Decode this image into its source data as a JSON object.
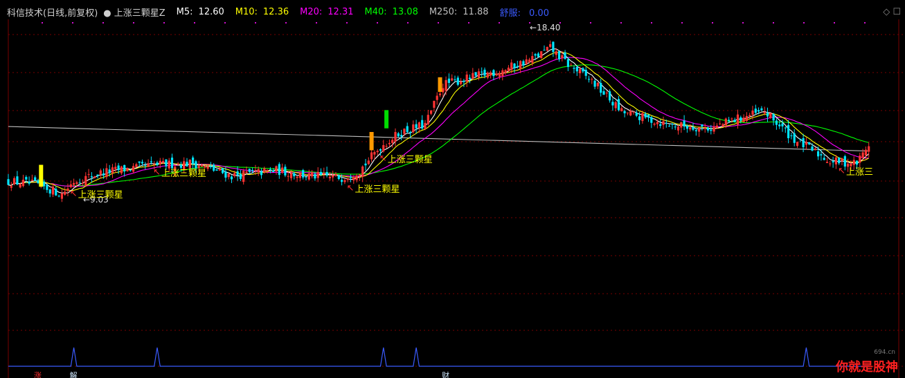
{
  "header": {
    "title": "科信技术(日线,前复权)",
    "indicator": "上涨三颗星Z",
    "ma": [
      {
        "label": "M5:",
        "value": "12.60",
        "color": "#ffffff"
      },
      {
        "label": "M10:",
        "value": "12.36",
        "color": "#ffff00"
      },
      {
        "label": "M20:",
        "value": "12.31",
        "color": "#ff00ff"
      },
      {
        "label": "M40:",
        "value": "13.08",
        "color": "#00ff00"
      },
      {
        "label": "M250:",
        "value": "11.88",
        "color": "#bfbfbf"
      }
    ],
    "extra_label": "舒服:",
    "extra_value": "0.00",
    "extra_color": "#3b5bff"
  },
  "colors": {
    "up": "#ff3333",
    "down": "#00e5ff",
    "signal": "#ffff00"
  },
  "chart_data": {
    "type": "candlestick",
    "y_low": 9.03,
    "y_high": 18.4,
    "annotations": [
      {
        "text": "18.40",
        "kind": "high"
      },
      {
        "text": "9.03",
        "kind": "low"
      },
      {
        "text": "上涨三颗星",
        "kind": "signal",
        "index": 22
      },
      {
        "text": "上涨三颗星",
        "kind": "signal",
        "index": 50
      },
      {
        "text": "上涨三颗星",
        "kind": "signal",
        "index": 115
      },
      {
        "text": "上涨三颗星",
        "kind": "signal",
        "index": 126
      },
      {
        "text": "上涨三",
        "kind": "signal",
        "index": 280
      }
    ],
    "signal_peaks": [
      22,
      50,
      126,
      137,
      268
    ],
    "bottom_labels": [
      {
        "text": "涨",
        "index": 10,
        "color": "#ff3030"
      },
      {
        "text": "解",
        "index": 22,
        "color": "#cfe8ff"
      },
      {
        "text": "财",
        "index": 147,
        "color": "#cfe8ff"
      }
    ]
  },
  "watermark": {
    "text": "你就是股神",
    "site": "694.cn"
  }
}
